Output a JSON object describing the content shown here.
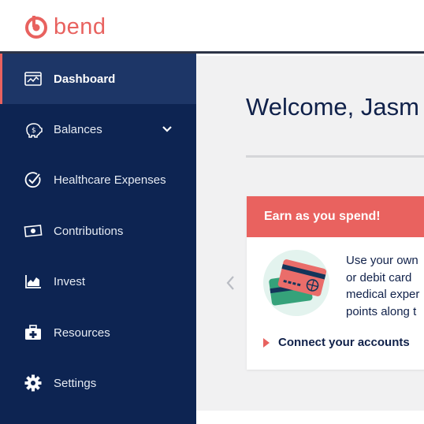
{
  "brand": {
    "name": "bend",
    "logo_icon": "bend-logo-icon",
    "accent_color": "#e8625f"
  },
  "colors": {
    "sidebar_bg": "#0d2452",
    "sidebar_active_bg": "#1d3667",
    "main_bg": "#f1f1f2",
    "card_header_bg": "#e9625f",
    "heading_text": "#10214a"
  },
  "sidebar": {
    "items": [
      {
        "label": "Dashboard",
        "icon": "dashboard-icon",
        "active": true
      },
      {
        "label": "Balances",
        "icon": "piggy-bank-icon",
        "expandable": true
      },
      {
        "label": "Healthcare Expenses",
        "icon": "check-circle-icon"
      },
      {
        "label": "Contributions",
        "icon": "cash-icon"
      },
      {
        "label": "Invest",
        "icon": "area-chart-icon"
      },
      {
        "label": "Resources",
        "icon": "medical-kit-icon"
      },
      {
        "label": "Settings",
        "icon": "gear-icon"
      }
    ]
  },
  "main": {
    "welcome": "Welcome, Jasm",
    "card": {
      "title": "Earn as you spend!",
      "illustration": "credit-cards-icon",
      "body_lines": [
        "Use your own",
        "or debit card",
        "medical exper",
        "points along t"
      ],
      "link_label": "Connect your accounts"
    }
  }
}
